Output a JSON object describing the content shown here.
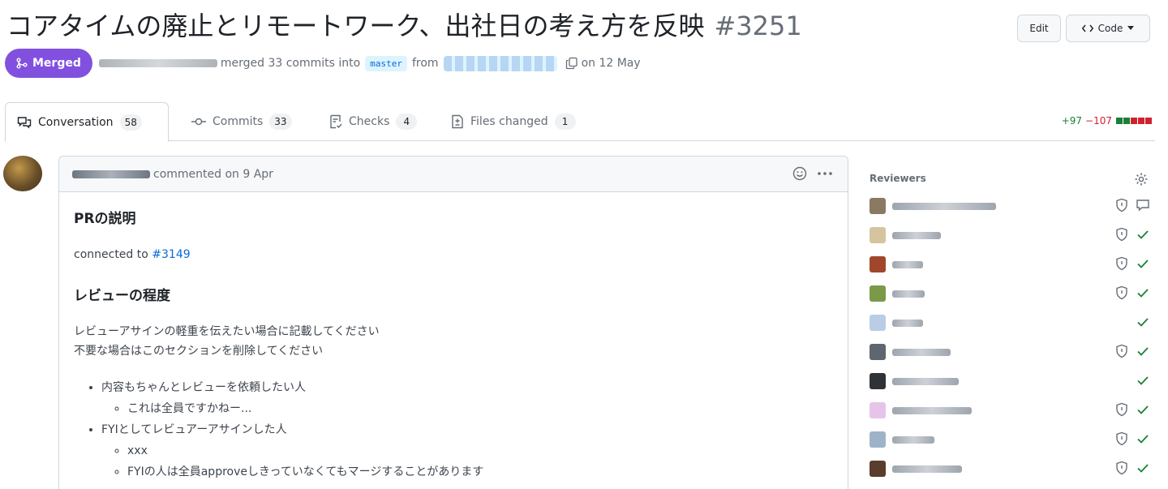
{
  "header": {
    "title": "コアタイムの廃止とリモートワーク、出社日の考え方を反映",
    "number": "#3251",
    "edit_label": "Edit",
    "code_label": "Code"
  },
  "meta": {
    "badge": "Merged",
    "merged_text": "merged 33 commits into",
    "base_branch": "master",
    "from_text": "from",
    "date_text": "on 12 May"
  },
  "tabs": [
    {
      "label": "Conversation",
      "count": "58"
    },
    {
      "label": "Commits",
      "count": "33"
    },
    {
      "label": "Checks",
      "count": "4"
    },
    {
      "label": "Files changed",
      "count": "1"
    }
  ],
  "diffstat": {
    "additions": "+97",
    "deletions": "−107"
  },
  "comment": {
    "action_text": "commented on 9 Apr",
    "heading1": "PRの説明",
    "connected_prefix": "connected to",
    "connected_link": "#3149",
    "heading2": "レビューの程度",
    "para_line1": "レビューアサインの軽重を伝えたい場合に記載してください",
    "para_line2": "不要な場合はこのセクションを削除してください",
    "list": [
      {
        "text": "内容もちゃんとレビューを依頼したい人",
        "sub": [
          "これは全員ですかねー..."
        ]
      },
      {
        "text": "FYIとしてレビュアーアサインした人",
        "sub": [
          "xxx",
          "FYIの人は全員approveしきっていなくてもマージすることがあります"
        ]
      }
    ]
  },
  "sidebar": {
    "reviewers_title": "Reviewers"
  },
  "colors": {
    "merged": "#8250df",
    "link": "#0969da",
    "approve": "#1a7f37",
    "delete": "#cf222e"
  }
}
